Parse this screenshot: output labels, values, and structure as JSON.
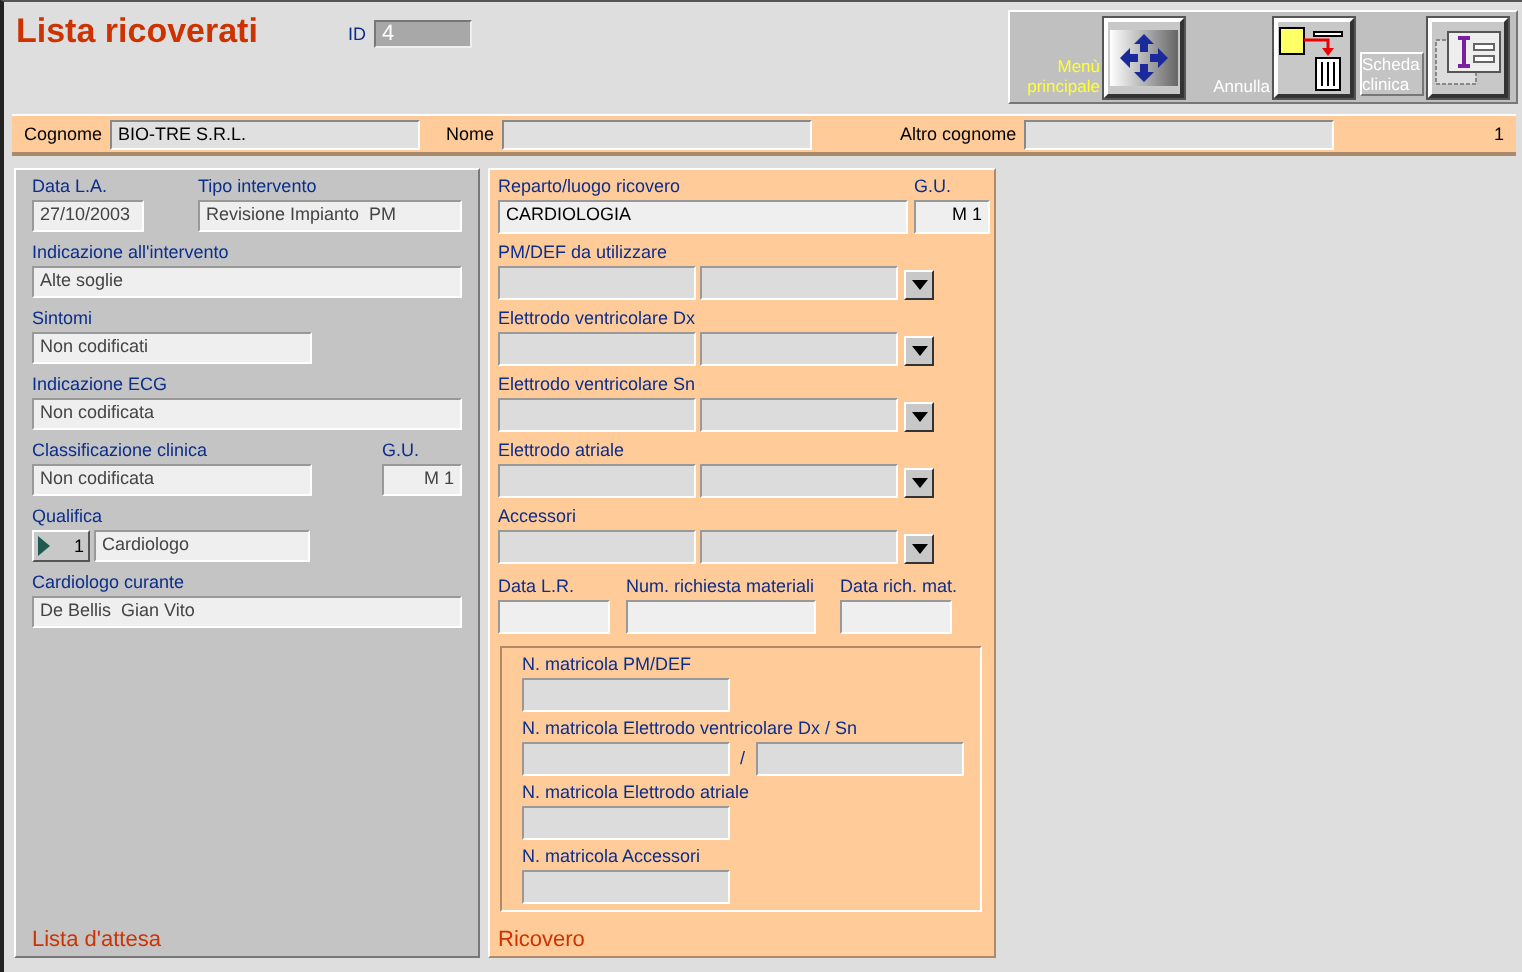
{
  "window": {
    "title": "Lista ricoverati",
    "id": {
      "label": "ID",
      "value": "4"
    }
  },
  "toolbar": [
    {
      "kind": "menu",
      "label": "Menù principale",
      "highlighted": true
    },
    {
      "kind": "cancel",
      "label": "Annulla",
      "highlighted": false
    },
    {
      "kind": "record",
      "label": "Scheda clinica",
      "highlighted": false
    }
  ],
  "patient_bar": {
    "fields": [
      {
        "label": "Cognome",
        "value": "BIO-TRE S.R.L."
      },
      {
        "label": "Nome"
      },
      {
        "label": "Altro cognome"
      }
    ],
    "counter": "1"
  },
  "waiting_list": {
    "title": "Lista d'attesa",
    "date": {
      "label": "Data L.A.",
      "value": "27/10/2003"
    },
    "procedure": {
      "label": "Tipo intervento",
      "value": "Revisione Impianto  PM"
    },
    "indication": {
      "label": "Indicazione all'intervento",
      "value": "Alte soglie"
    },
    "symptoms": {
      "label": "Sintomi",
      "value": "Non codificati"
    },
    "ecg": {
      "label": "Indicazione ECG",
      "value": "Non codificata"
    },
    "classification": {
      "label": "Classificazione clinica",
      "value": "Non codificata"
    },
    "gu": {
      "label": "G.U.",
      "value": "M 1"
    },
    "qualification": {
      "label": "Qualifica",
      "code": "1",
      "value": "Cardiologo"
    },
    "cardiologist": {
      "label": "Cardiologo curante",
      "value": "De Bellis  Gian Vito"
    }
  },
  "admission": {
    "title": "Ricovero",
    "ward": {
      "label": "Reparto/luogo ricovero",
      "value": "CARDIOLOGIA"
    },
    "gu": {
      "label": "G.U.",
      "value": "M 1"
    },
    "devices": [
      {
        "label": "PM/DEF da utilizzare"
      },
      {
        "label": "Elettrodo ventricolare Dx"
      },
      {
        "label": "Elettrodo ventricolare Sn"
      },
      {
        "label": "Elettrodo atriale"
      },
      {
        "label": "Accessori"
      }
    ],
    "dates": [
      {
        "label": "Data L.R."
      },
      {
        "label": "Num. richiesta materiali"
      },
      {
        "label": "Data rich. mat."
      }
    ],
    "serials": [
      {
        "kind": "single",
        "label": "N. matricola PM/DEF"
      },
      {
        "kind": "pair",
        "label": "N. matricola Elettrodo ventricolare Dx / Sn",
        "separator": "/"
      },
      {
        "kind": "single",
        "label": "N. matricola Elettrodo atriale"
      },
      {
        "kind": "single",
        "label": "N. matricola Accessori"
      }
    ]
  }
}
